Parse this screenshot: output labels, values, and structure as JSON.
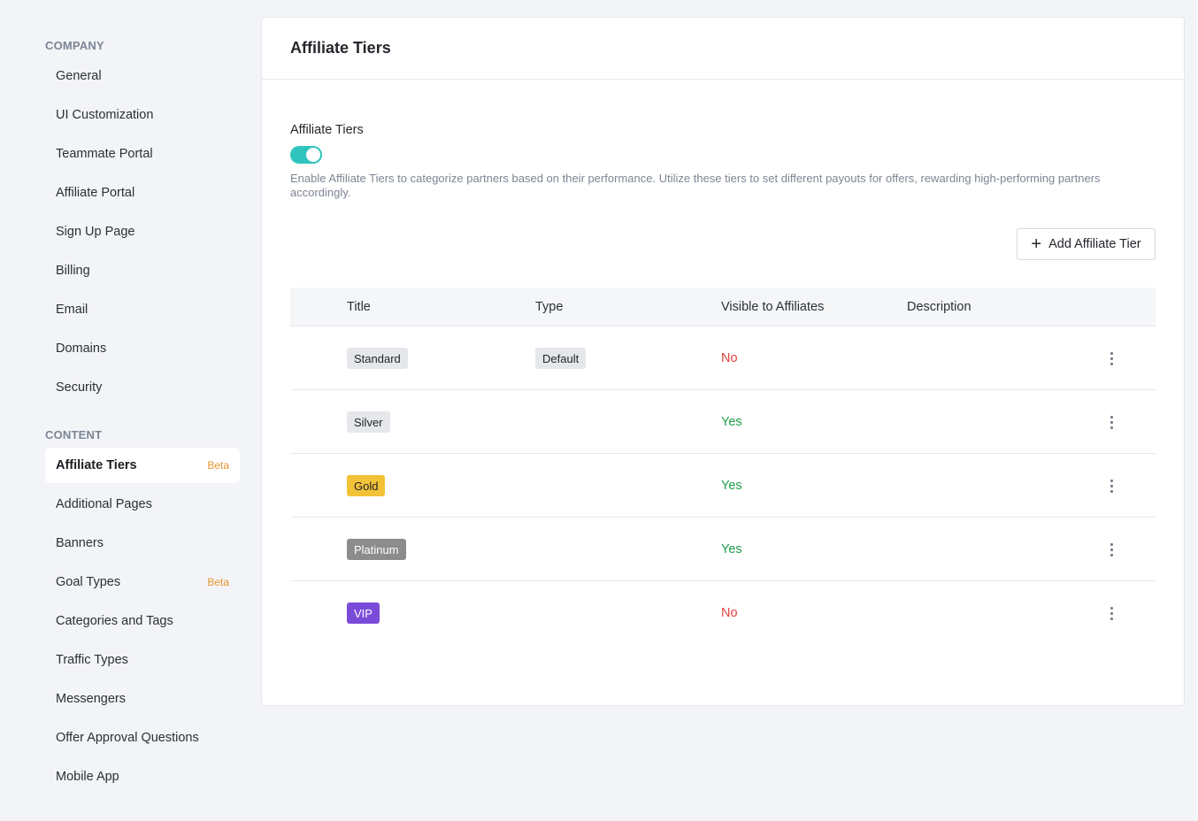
{
  "sidebar": {
    "company_label": "COMPANY",
    "company_items": [
      {
        "label": "General"
      },
      {
        "label": "UI Customization"
      },
      {
        "label": "Teammate Portal"
      },
      {
        "label": "Affiliate Portal"
      },
      {
        "label": "Sign Up Page"
      },
      {
        "label": "Billing"
      },
      {
        "label": "Email"
      },
      {
        "label": "Domains"
      },
      {
        "label": "Security"
      }
    ],
    "content_label": "CONTENT",
    "content_items": [
      {
        "label": "Affiliate Tiers",
        "badge": "Beta",
        "active": true
      },
      {
        "label": "Additional Pages"
      },
      {
        "label": "Banners"
      },
      {
        "label": "Goal Types",
        "badge": "Beta"
      },
      {
        "label": "Categories and Tags"
      },
      {
        "label": "Traffic Types"
      },
      {
        "label": "Messengers"
      },
      {
        "label": "Offer Approval Questions"
      },
      {
        "label": "Mobile App"
      }
    ]
  },
  "main": {
    "title": "Affiliate Tiers",
    "setting_label": "Affiliate Tiers",
    "toggle_on": true,
    "help_text": "Enable Affiliate Tiers to categorize partners based on their performance. Utilize these tiers to set different payouts for offers, rewarding high-performing partners accordingly.",
    "add_button_label": "Add Affiliate Tier",
    "table": {
      "headers": {
        "title": "Title",
        "type": "Type",
        "visible": "Visible to Affiliates",
        "description": "Description"
      },
      "rows": [
        {
          "title": "Standard",
          "type": "Default",
          "visible": "No",
          "description": "",
          "color": "#e5e7eb",
          "text_color": "#1f2328"
        },
        {
          "title": "Silver",
          "type": "",
          "visible": "Yes",
          "description": "",
          "color": "#e5e7eb",
          "text_color": "#1f2328"
        },
        {
          "title": "Gold",
          "type": "",
          "visible": "Yes",
          "description": "",
          "color": "#f2c237",
          "text_color": "#1f2328"
        },
        {
          "title": "Platinum",
          "type": "",
          "visible": "Yes",
          "description": "",
          "color": "#8c8c8c",
          "text_color": "#ffffff"
        },
        {
          "title": "VIP",
          "type": "",
          "visible": "No",
          "description": "",
          "color": "#7a4bd8",
          "text_color": "#ffffff"
        }
      ]
    }
  },
  "colors": {
    "accent": "#2fc4bd",
    "beta": "#e8942a",
    "no": "#e2413c",
    "yes": "#1f9e4a"
  }
}
